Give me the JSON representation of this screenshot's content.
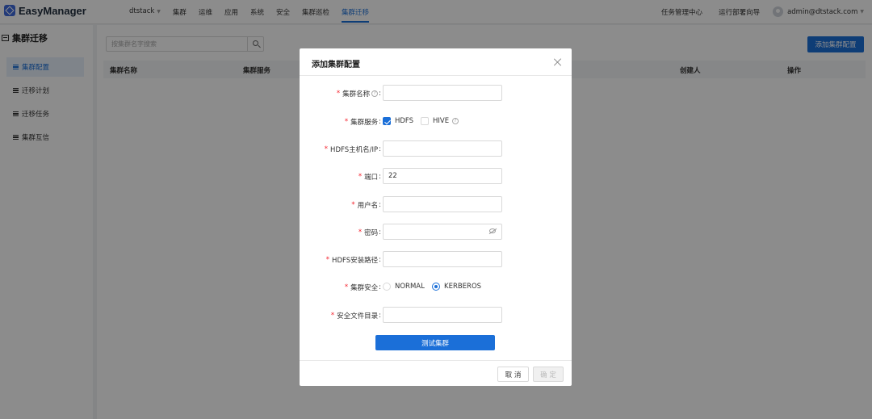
{
  "header": {
    "brand": "EasyManager",
    "nav": [
      {
        "label": "dtstack"
      },
      {
        "label": "集群"
      },
      {
        "label": "运维"
      },
      {
        "label": "应用"
      },
      {
        "label": "系统"
      },
      {
        "label": "安全"
      },
      {
        "label": "集群巡检"
      },
      {
        "label": "集群迁移",
        "active": true
      }
    ],
    "task_center": "任务管理中心",
    "deploy_wizard": "运行部署向导",
    "user": "admin@dtstack.com",
    "colors": {
      "accent": "#1b6fd8"
    }
  },
  "sidebar": {
    "title": "集群迁移",
    "items": [
      {
        "label": "集群配置",
        "active": true
      },
      {
        "label": "迁移计划"
      },
      {
        "label": "迁移任务"
      },
      {
        "label": "集群互信"
      }
    ]
  },
  "main": {
    "search_placeholder": "按集群名字搜索",
    "add_button": "添加集群配置",
    "columns": [
      "集群名称",
      "集群服务",
      "创建人",
      "操作"
    ]
  },
  "modal": {
    "title": "添加集群配置",
    "fields": {
      "cluster_name": {
        "label": "集群名称",
        "value": ""
      },
      "services": {
        "label": "集群服务",
        "options": [
          {
            "label": "HDFS",
            "checked": true
          },
          {
            "label": "HIVE",
            "checked": false
          }
        ]
      },
      "host": {
        "label": "HDFS主机名/IP",
        "value": ""
      },
      "port": {
        "label": "端口",
        "value": "22"
      },
      "username": {
        "label": "用户名",
        "value": ""
      },
      "password": {
        "label": "密码",
        "value": ""
      },
      "install_path": {
        "label": "HDFS安装路径",
        "value": ""
      },
      "security": {
        "label": "集群安全",
        "options": [
          {
            "label": "NORMAL",
            "selected": false
          },
          {
            "label": "KERBEROS",
            "selected": true
          }
        ]
      },
      "security_dir": {
        "label": "安全文件目录",
        "value": ""
      }
    },
    "test_button": "测试集群",
    "cancel_button": "取 消",
    "ok_button": "确 定"
  }
}
